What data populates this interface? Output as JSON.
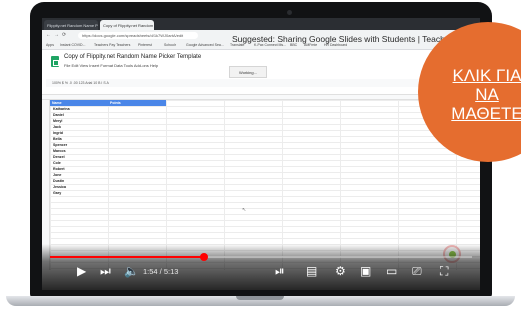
{
  "browser": {
    "tabs": [
      {
        "label": "Flippity.net Random Name P"
      },
      {
        "label": "Copy of Flippity.net Random"
      }
    ],
    "url": "https://docs.google.com/spreadsheets/d/1k7WJ0artA/edit",
    "bookmarks": [
      "Apps",
      "Instant COVID...",
      "Teachers Pay Teachers",
      "Pinterest",
      "Schoolr",
      "Google Advanced Sea...",
      "Translate",
      "K-Pax Connect Ms...",
      "BBC",
      "AMFmte",
      "HR Dashboard"
    ]
  },
  "sheet": {
    "title": "Copy of Flippity.net Random Name Picker Template",
    "menu": "File  Edit  View  Insert  Format  Data  Tools  Add-ons  Help",
    "toolbar_text": "100%  $  %  .0  .00  123  Arial  10  B  I  S  A",
    "status": "Working...",
    "headers": [
      "Name",
      "Points"
    ],
    "names": [
      "Katharina",
      "Daniel",
      "Meryl",
      "Jack",
      "Ingrid",
      "Bella",
      "Spencer",
      "Marcos",
      "Denzel",
      "Cole",
      "Robert",
      "Jone",
      "Dustin",
      "Jessica",
      "Gary"
    ]
  },
  "video": {
    "suggestion": "Suggested: Sharing Google Slides with Students | Teacher Tips",
    "time": "1:54 / 5:13",
    "progress": 0.364
  },
  "badge": {
    "lines": [
      "ΚΛΙΚ ΓΙΑ",
      "ΝΑ",
      "ΜΑΘΕΤΕ"
    ],
    "color": "#e56d2f"
  }
}
